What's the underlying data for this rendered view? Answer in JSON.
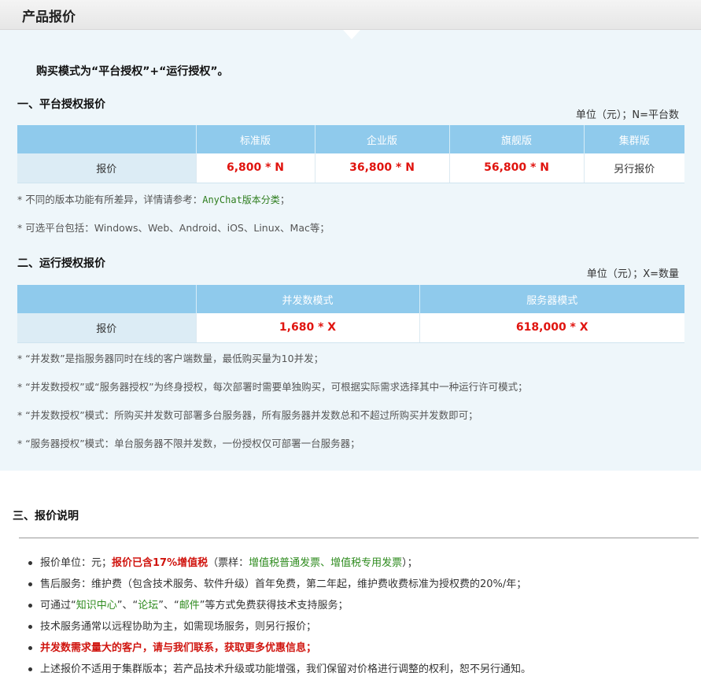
{
  "header": {
    "title": "产品报价"
  },
  "intro": "购买模式为“平台授权”+“运行授权”。",
  "section1": {
    "title": "一、平台授权报价",
    "unit": "单位（元）；N=平台数",
    "columns": [
      "",
      "标准版",
      "企业版",
      "旗舰版",
      "集群版"
    ],
    "row_label": "报价",
    "prices": [
      "6,800 * N",
      "36,800 * N",
      "56,800 * N"
    ],
    "cluster_price": "另行报价",
    "note1_prefix": "* 不同的版本功能有所差异，详情请参考：",
    "note1_link": "AnyChat版本分类",
    "note1_suffix": "；",
    "note2": "* 可选平台包括：Windows、Web、Android、iOS、Linux、Mac等；"
  },
  "section2": {
    "title": "二、运行授权报价",
    "unit": "单位（元）；X=数量",
    "columns": [
      "",
      "并发数模式",
      "服务器模式"
    ],
    "row_label": "报价",
    "prices": [
      "1,680 * X",
      "618,000 * X"
    ],
    "notes": [
      "*  “并发数”是指服务器同时在线的客户端数量，最低购买量为10并发；",
      "*  “并发数授权”或“服务器授权”为终身授权，每次部署时需要单独购买，可根据实际需求选择其中一种运行许可模式；",
      "*  “并发数授权”模式：所购买并发数可部署多台服务器，所有服务器并发数总和不超过所购买并发数即可；",
      "*  “服务器授权”模式：单台服务器不限并发数，一份授权仅可部署一台服务器；"
    ]
  },
  "section3": {
    "title": "三、报价说明",
    "item1": {
      "prefix": "报价单位：元；",
      "highlight": "报价已含17%增值税",
      "middle": "（票样：",
      "link": "增值税普通发票、增值税专用发票",
      "suffix": "）；"
    },
    "item2": "售后服务：维护费（包含技术服务、软件升级）首年免费，第二年起，维护费收费标准为授权费的20%/年；",
    "item3": {
      "prefix": "可通过“",
      "link1": "知识中心",
      "sep1": "”、“",
      "link2": "论坛",
      "sep2": "”、“",
      "link3": "邮件",
      "suffix": "”等方式免费获得技术支持服务；"
    },
    "item4": "技术服务通常以远程协助为主，如需现场服务，则另行报价；",
    "item5": "并发数需求量大的客户，请与我们联系，获取更多优惠信息；",
    "item6": "上述报价不适用于集群版本；若产品技术升级或功能增强，我们保留对价格进行调整的权利，恕不另行通知。"
  },
  "colors": {
    "table_header": "#8fcaec",
    "row_label_bg": "#dcecf5",
    "price_red": "#e0140f",
    "panel_bg": "#eef6fa",
    "link_green": "#2e8b1e"
  }
}
